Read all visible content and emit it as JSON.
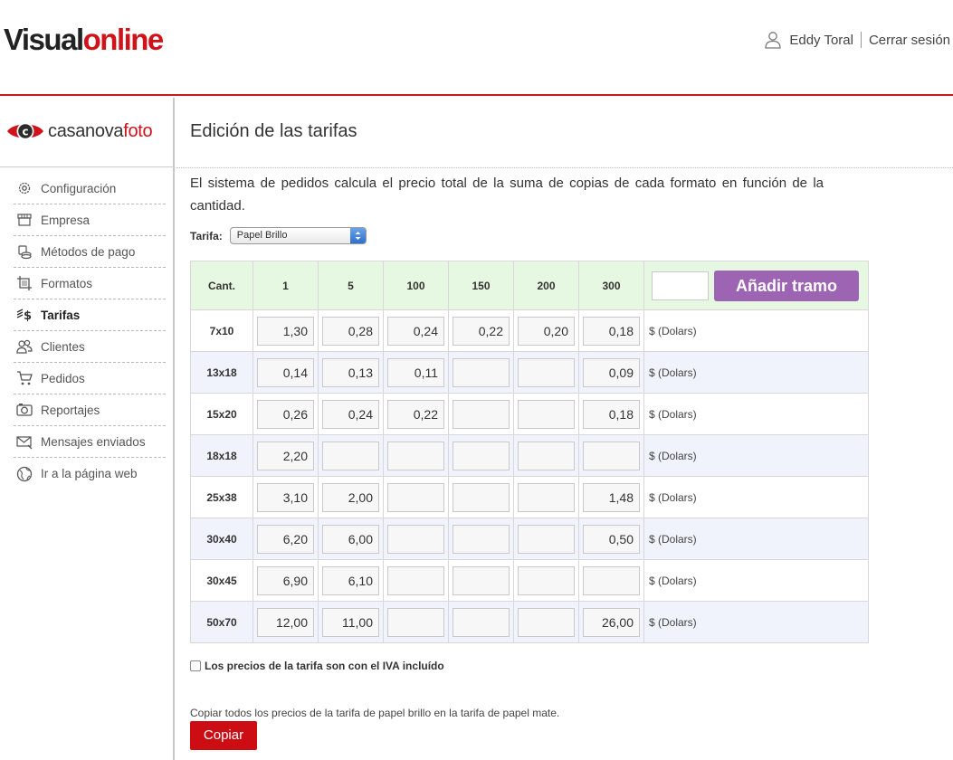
{
  "header": {
    "brand_part1": "Visual",
    "brand_part2": "online",
    "user_name": "Eddy Toral",
    "logout": "Cerrar sesión"
  },
  "sidebar": {
    "logo_text_a": "casanova",
    "logo_text_b": "foto",
    "items": [
      {
        "label": "Configuración",
        "icon": "gear-icon"
      },
      {
        "label": "Empresa",
        "icon": "store-icon"
      },
      {
        "label": "Métodos de pago",
        "icon": "coins-icon"
      },
      {
        "label": "Formatos",
        "icon": "crop-icon"
      },
      {
        "label": "Tarifas",
        "icon": "money-icon",
        "active": true
      },
      {
        "label": "Clientes",
        "icon": "users-icon"
      },
      {
        "label": "Pedidos",
        "icon": "cart-icon"
      },
      {
        "label": "Reportajes",
        "icon": "camera-icon"
      },
      {
        "label": "Mensajes enviados",
        "icon": "mail-icon"
      },
      {
        "label": "Ir a la página web",
        "icon": "globe-icon"
      }
    ]
  },
  "main": {
    "title": "Edición de las tarifas",
    "description": "El sistema de pedidos calcula el precio total de la suma de copias de cada formato en función de la cantidad.",
    "tarifa_label": "Tarifa:",
    "tarifa_selected": "Papel Brillo",
    "table": {
      "qty_header": "Cant.",
      "quantities": [
        "1",
        "5",
        "100",
        "150",
        "200",
        "300"
      ],
      "add_button": "Añadir tramo",
      "unit": "$ (Dolars)",
      "rows": [
        {
          "format": "7x10",
          "prices": [
            "1,30",
            "0,28",
            "0,24",
            "0,22",
            "0,20",
            "0,18"
          ]
        },
        {
          "format": "13x18",
          "prices": [
            "0,14",
            "0,13",
            "0,11",
            "",
            "",
            "0,09"
          ]
        },
        {
          "format": "15x20",
          "prices": [
            "0,26",
            "0,24",
            "0,22",
            "",
            "",
            "0,18"
          ]
        },
        {
          "format": "18x18",
          "prices": [
            "2,20",
            "",
            "",
            "",
            "",
            ""
          ]
        },
        {
          "format": "25x38",
          "prices": [
            "3,10",
            "2,00",
            "",
            "",
            "",
            "1,48"
          ]
        },
        {
          "format": "30x40",
          "prices": [
            "6,20",
            "6,00",
            "",
            "",
            "",
            "0,50"
          ]
        },
        {
          "format": "30x45",
          "prices": [
            "6,90",
            "6,10",
            "",
            "",
            "",
            ""
          ]
        },
        {
          "format": "50x70",
          "prices": [
            "12,00",
            "11,00",
            "",
            "",
            "",
            "26,00"
          ]
        }
      ]
    },
    "iva_label": "Los precios de la tarifa son con el IVA incluído",
    "copy_text": "Copiar todos los precios de la tarifa de papel brillo en la tarifa de papel mate.",
    "copy_button": "Copiar"
  }
}
